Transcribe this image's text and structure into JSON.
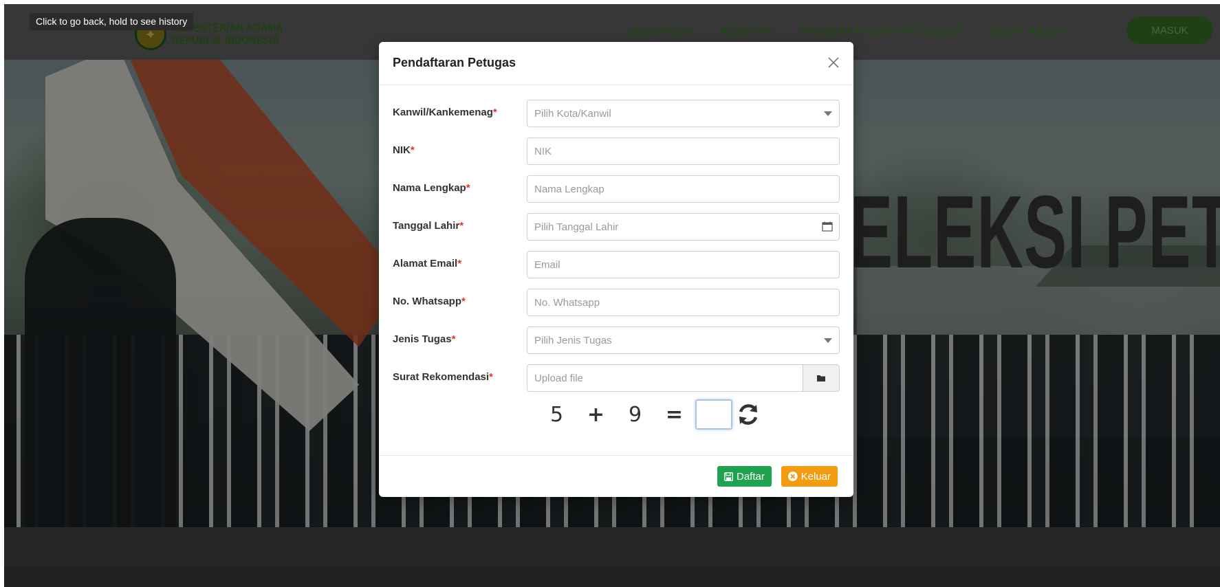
{
  "browser": {
    "tooltip": "Click to go back, hold to see history"
  },
  "header": {
    "logo_line1": "KEMENTERIAN AGAMA",
    "logo_line2": "REPUBLIK INDONESIA",
    "nav": [
      "BERANDA",
      "KONTAK",
      "PENDAFTARAN PETUGAS",
      "BUAT AKUN"
    ],
    "login_label": "MASUK",
    "colors": {
      "nav_text": "#3f8a2a",
      "login_bg": "#3c7a27"
    }
  },
  "hero": {
    "title": "ELEKSI PETUG"
  },
  "modal": {
    "title": "Pendaftaran Petugas",
    "required_mark": "*",
    "fields": {
      "kanwil": {
        "label": "Kanwil/Kankemenag",
        "placeholder": "Pilih Kota/Kanwil"
      },
      "nik": {
        "label": "NIK",
        "placeholder": "NIK",
        "value": ""
      },
      "nama": {
        "label": "Nama Lengkap",
        "placeholder": "Nama Lengkap",
        "value": ""
      },
      "tanggal": {
        "label": "Tanggal Lahir",
        "placeholder": "Pilih Tanggal Lahir",
        "value": ""
      },
      "email": {
        "label": "Alamat Email",
        "placeholder": "Email",
        "value": ""
      },
      "whatsapp": {
        "label": "No. Whatsapp",
        "placeholder": "No. Whatsapp",
        "value": ""
      },
      "jenis_tugas": {
        "label": "Jenis Tugas",
        "placeholder": "Pilih Jenis Tugas"
      },
      "surat": {
        "label": "Surat Rekomendasi",
        "placeholder": "Upload file",
        "value": ""
      }
    },
    "captcha": {
      "a": "5",
      "op": "+",
      "b": "9",
      "eq": "=",
      "answer": ""
    },
    "buttons": {
      "submit": "Daftar",
      "cancel": "Keluar"
    },
    "colors": {
      "required": "#e0342b",
      "submit_bg": "#1fa351",
      "cancel_bg": "#f39c12"
    },
    "icons": {
      "close": "close-icon",
      "calendar": "calendar-icon",
      "folder": "folder-icon",
      "refresh": "refresh-icon",
      "save": "save-icon",
      "cancel": "times-circle-icon",
      "caret": "caret-down-icon"
    }
  }
}
